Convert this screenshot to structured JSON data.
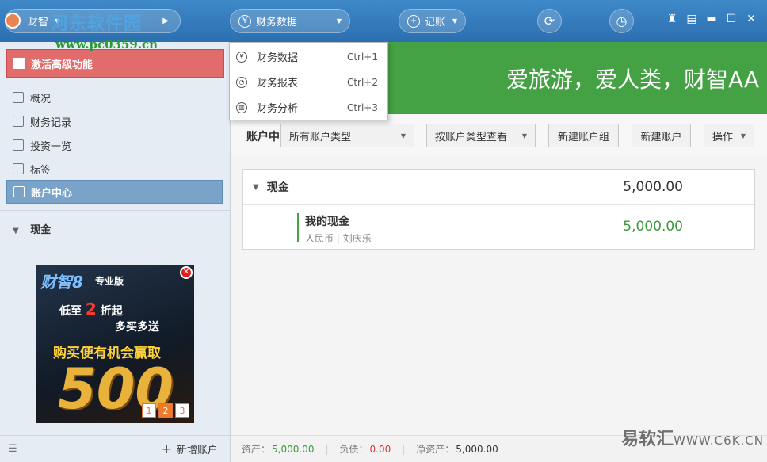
{
  "topbar": {
    "app_label": "财智",
    "watermark_site": "河东软件园",
    "watermark_url": "www.pc0359.cn",
    "finance_label": "财务数据",
    "record_label": "记账",
    "icons": {
      "finance": "yuan-icon",
      "record": "plus-icon",
      "sync": "sync-icon",
      "clock": "clock-icon"
    }
  },
  "dropdown": {
    "items": [
      {
        "label": "财务数据",
        "shortcut": "Ctrl+1"
      },
      {
        "label": "财务报表",
        "shortcut": "Ctrl+2"
      },
      {
        "label": "财务分析",
        "shortcut": "Ctrl+3"
      }
    ]
  },
  "sidebar": {
    "activate_label": "激活高级功能",
    "items": [
      {
        "label": "概况"
      },
      {
        "label": "财务记录"
      },
      {
        "label": "投资一览"
      },
      {
        "label": "标签"
      },
      {
        "label": "账户中心",
        "active": true
      }
    ],
    "group_label": "现金",
    "ad": {
      "brand": "财智8",
      "edition": "专业版",
      "line1_prefix": "低至",
      "line1_num": "2",
      "line1_suffix": "折起",
      "line2": "多买多送",
      "line3": "购买便有机会赢取",
      "big_num": "500",
      "pages": [
        "1",
        "2",
        "3"
      ]
    },
    "footer_add_label": "新增账户"
  },
  "banner": {
    "text": "爱旅游，爱人类，财智AA"
  },
  "toolbar": {
    "title": "账户中",
    "type_select": "所有账户类型",
    "view_select": "按账户类型查看",
    "new_group": "新建账户组",
    "new_account": "新建账户",
    "actions": "操作"
  },
  "accounts": {
    "group_name": "现金",
    "group_amount": "5,000.00",
    "items": [
      {
        "name": "我的现金",
        "currency": "人民币",
        "owner": "刘庆乐",
        "amount": "5,000.00"
      }
    ]
  },
  "status": {
    "assets_label": "资产：",
    "assets_value": "5,000.00",
    "liab_label": "负债：",
    "liab_value": "0.00",
    "net_label": "净资产：",
    "net_value": "5,000.00"
  },
  "watermark_bottom": {
    "brand": "易软汇",
    "url": "WWW.C6K.CN"
  },
  "colors": {
    "green": "#44a144",
    "blue": "#2c6fb0",
    "red": "#e26b6b"
  }
}
